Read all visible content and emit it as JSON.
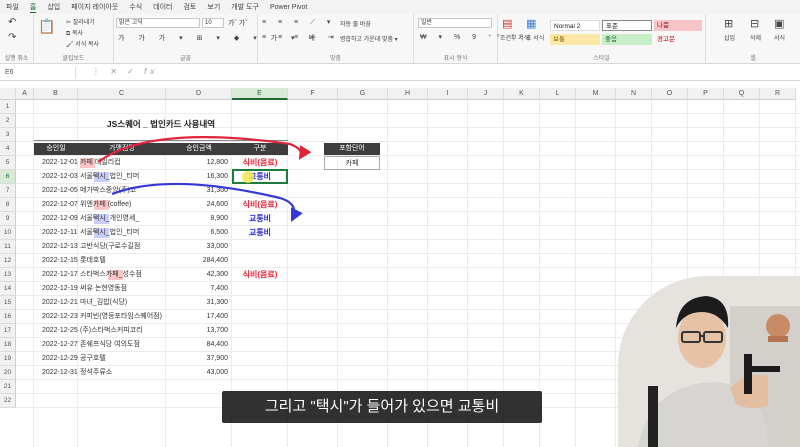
{
  "menu": {
    "items": [
      "파일",
      "홈",
      "삽입",
      "페이지 레이아웃",
      "수식",
      "데이터",
      "검토",
      "보기",
      "개발 도구",
      "Power Pivot"
    ],
    "active": "홈"
  },
  "ribbon": {
    "groups": [
      "실행 취소",
      "클립보드",
      "글꼴",
      "맞춤",
      "표시 형식",
      "스타일",
      "셀"
    ],
    "clipboard": {
      "cut": "잘라내기",
      "copy": "복사",
      "format_painter": "서식 복사"
    },
    "font": {
      "name": "맑은 고딕",
      "size": "10"
    },
    "align": {
      "wrap": "자동 줄 바꿈",
      "merge": "병합하고 가운데 맞춤"
    },
    "number": {
      "format": "일반"
    },
    "styles": {
      "conditional": "조건부 서식",
      "table": "표 서식",
      "normal2": "Normal 2",
      "normal": "표준",
      "bad": "나쁨",
      "good": "좋음",
      "neutral": "보통",
      "warning": "경고문"
    },
    "cells": {
      "insert": "삽입",
      "delete": "삭제",
      "format": "서식"
    }
  },
  "formula_bar": {
    "name_box": "E6",
    "fx": "fx",
    "value": ""
  },
  "colors": {
    "header_bg": "#3d3d3d",
    "accent_green": "#1e6b34",
    "red_category": "#e0243a",
    "blue_category": "#2b2fd6"
  },
  "columns": [
    "A",
    "B",
    "C",
    "D",
    "E",
    "F",
    "G",
    "H",
    "I",
    "J",
    "K",
    "L",
    "M",
    "N",
    "O",
    "P",
    "Q",
    "R"
  ],
  "rows": [
    "1",
    "2",
    "3",
    "4",
    "5",
    "6",
    "7",
    "8",
    "9",
    "10",
    "11",
    "12",
    "13",
    "14",
    "15",
    "16",
    "17",
    "18",
    "19",
    "20",
    "21",
    "22"
  ],
  "sheet": {
    "title": "JS스퀘어 _ 법인카드 사용내역",
    "headers": {
      "date": "승인일",
      "merchant": "가맹점명",
      "amount": "승인금액",
      "category": "구분"
    },
    "lookup_header": "포함단어",
    "lookup_value": "카페",
    "records": [
      {
        "date": "2022-12-01",
        "merchant": "카페 데일리컵",
        "hl": "카페",
        "amount": "12,800",
        "category": "식비(음료)"
      },
      {
        "date": "2022-12-03",
        "merchant": "서울택시_법인_티머",
        "hl": "택시",
        "amount": "16,300",
        "category": "교통비"
      },
      {
        "date": "2022-12-05",
        "merchant": "메가박스중앙(주)코",
        "hl": "",
        "amount": "31,300",
        "category": ""
      },
      {
        "date": "2022-12-07",
        "merchant": "위엔카페 (coffee)",
        "hl": "카페",
        "amount": "24,600",
        "category": "식비(음료)"
      },
      {
        "date": "2022-12-09",
        "merchant": "서울택시_개인영세_",
        "hl": "택시",
        "amount": "8,900",
        "category": "교통비"
      },
      {
        "date": "2022-12-11",
        "merchant": "서울택시_법인_티머",
        "hl": "택시",
        "amount": "6,500",
        "category": "교통비"
      },
      {
        "date": "2022-12-13",
        "merchant": "고반식당(구로수길점",
        "hl": "",
        "amount": "33,000",
        "category": ""
      },
      {
        "date": "2022-12-15",
        "merchant": "롯데호텔",
        "hl": "",
        "amount": "284,400",
        "category": ""
      },
      {
        "date": "2022-12-17",
        "merchant": "스타벅스카페_성수점",
        "hl": "카페",
        "amount": "42,300",
        "category": "식비(음료)"
      },
      {
        "date": "2022-12-19",
        "merchant": "써유 논현영동점",
        "hl": "",
        "amount": "7,400",
        "category": ""
      },
      {
        "date": "2022-12-21",
        "merchant": "마녀_김밥(식당)",
        "hl": "",
        "amount": "31,300",
        "category": ""
      },
      {
        "date": "2022-12-23",
        "merchant": "커피빈(영등포타임스퀘어점)",
        "hl": "",
        "amount": "17,400",
        "category": ""
      },
      {
        "date": "2022-12-25",
        "merchant": "(주)스타벅스커피코리",
        "hl": "",
        "amount": "13,700",
        "category": ""
      },
      {
        "date": "2022-12-27",
        "merchant": "존쉐프식당 여의도점",
        "hl": "",
        "amount": "84,400",
        "category": ""
      },
      {
        "date": "2022-12-29",
        "merchant": "공구호텔",
        "hl": "",
        "amount": "37,900",
        "category": ""
      },
      {
        "date": "2022-12-31",
        "merchant": "정석주류소",
        "hl": "",
        "amount": "43,000",
        "category": ""
      }
    ]
  },
  "subtitle": "그리고 \"택시\"가 들어가 있으면 교통비"
}
